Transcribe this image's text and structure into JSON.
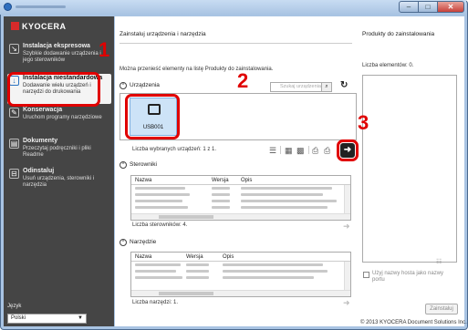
{
  "brand": {
    "logo": "KYOCERA"
  },
  "sidebar": {
    "items": [
      {
        "title": "Instalacja ekspresowa",
        "desc": "Szybkie dodawanie urządzenia i jego sterowników"
      },
      {
        "title": "Instalacja niestandardowa",
        "desc": "Dodawanie wielu urządzeń i narzędzi do drukowania"
      },
      {
        "title": "Konserwacja",
        "desc": "Uruchom programy narzędziowe"
      },
      {
        "title": "Dokumenty",
        "desc": "Przeczytaj podręczniki i pliki Readme"
      },
      {
        "title": "Odinstaluj",
        "desc": "Usuń urządzenia, sterowniki i narzędzia"
      }
    ],
    "language_label": "Język",
    "language_value": "Polski"
  },
  "callouts": {
    "n1": "1",
    "n2": "2",
    "n3": "3"
  },
  "main": {
    "header": "Zainstaluj urządzenia i narzędzia",
    "hint": "Można przenieść elementy na listę Produkty do zainstalowania.",
    "devices": {
      "label": "Urządzenia",
      "search_placeholder": "Szukaj urządzenia",
      "device_name": "USB001",
      "selected_count": "Liczba wybranych urządzeń: 1 z 1."
    },
    "drivers": {
      "label": "Sterowniki",
      "columns": [
        "Nazwa",
        "Wersja",
        "Opis"
      ],
      "count": "Liczba sterowników: 4."
    },
    "tools": {
      "label": "Narzędzie",
      "columns": [
        "Nazwa",
        "Wersja",
        "Opis"
      ],
      "count": "Liczba narzędzi: 1."
    }
  },
  "right": {
    "title": "Produkty do zainstalowania",
    "count": "Liczba elementów: 0.",
    "checkbox_label": "Użyj nazwy hosta jako nazwy portu",
    "install_button": "Zainstaluj"
  },
  "footer": {
    "copyright": "© 2013 KYOCERA Document Solutions Inc."
  },
  "colors": {
    "accent_red": "#e00000",
    "sidebar_bg": "#454545",
    "selection": "#cde3f7"
  },
  "icons": [
    "app-icon",
    "minimize-icon",
    "maximize-icon",
    "close-icon",
    "printer-icon",
    "refresh-icon",
    "search-icon",
    "arrow-right-icon"
  ]
}
